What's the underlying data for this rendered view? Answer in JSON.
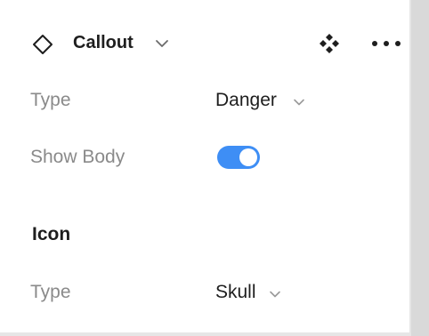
{
  "header": {
    "title": "Callout",
    "component_icon": "diamond-outline-icon",
    "component_set_icon": "four-diamonds-icon",
    "more_icon": "ellipsis-horizontal-icon"
  },
  "properties": [
    {
      "label": "Type",
      "value": "Danger",
      "control": "dropdown"
    },
    {
      "label": "Show Body",
      "value": true,
      "control": "toggle"
    }
  ],
  "icon_section": {
    "title": "Icon",
    "properties": [
      {
        "label": "Type",
        "value": "Skull",
        "control": "dropdown"
      }
    ]
  },
  "colors": {
    "toggle_on": "#3e8ef5",
    "label_text": "#8a8a8a",
    "value_text": "#1e1e1e"
  }
}
